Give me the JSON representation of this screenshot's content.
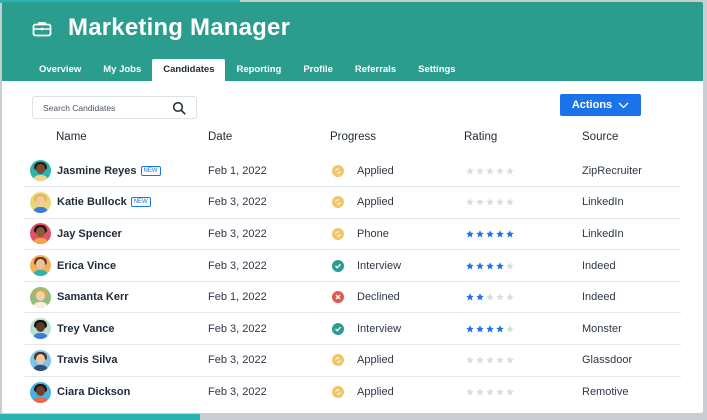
{
  "header": {
    "title": "Marketing Manager",
    "tabs": [
      {
        "label": "Overview",
        "active": false
      },
      {
        "label": "My Jobs",
        "active": false
      },
      {
        "label": "Candidates",
        "active": true
      },
      {
        "label": "Reporting",
        "active": false
      },
      {
        "label": "Profile",
        "active": false
      },
      {
        "label": "Referrals",
        "active": false
      },
      {
        "label": "Settings",
        "active": false
      }
    ]
  },
  "toolbar": {
    "search_placeholder": "Search Candidates",
    "actions_label": "Actions"
  },
  "table": {
    "headers": {
      "name": "Name",
      "date": "Date",
      "progress": "Progress",
      "rating": "Rating",
      "source": "Source"
    },
    "new_badge": "NEW",
    "rows": [
      {
        "name": "Jasmine Reyes",
        "new": true,
        "date": "Feb 1, 2022",
        "progress": "Applied",
        "status": "applied",
        "rating": 0,
        "source": "ZipRecruiter",
        "avatar": "jasmine"
      },
      {
        "name": "Katie Bullock",
        "new": true,
        "date": "Feb 3, 2022",
        "progress": "Applied",
        "status": "applied",
        "rating": 0,
        "source": "LinkedIn",
        "avatar": "katie"
      },
      {
        "name": "Jay Spencer",
        "new": false,
        "date": "Feb 3, 2022",
        "progress": "Phone",
        "status": "applied",
        "rating": 5,
        "source": "LinkedIn",
        "avatar": "jay"
      },
      {
        "name": "Erica Vince",
        "new": false,
        "date": "Feb 3, 2022",
        "progress": "Interview",
        "status": "interview",
        "rating": 4,
        "source": "Indeed",
        "avatar": "erica"
      },
      {
        "name": "Samanta Kerr",
        "new": false,
        "date": "Feb 1, 2022",
        "progress": "Declined",
        "status": "declined",
        "rating": 2,
        "source": "Indeed",
        "avatar": "samanta"
      },
      {
        "name": "Trey Vance",
        "new": false,
        "date": "Feb 3, 2022",
        "progress": "Interview",
        "status": "interview",
        "rating": 4,
        "source": "Monster",
        "avatar": "trey"
      },
      {
        "name": "Travis Silva",
        "new": false,
        "date": "Feb 3, 2022",
        "progress": "Applied",
        "status": "applied",
        "rating": 0,
        "source": "Glassdoor",
        "avatar": "travis"
      },
      {
        "name": "Ciara Dickson",
        "new": false,
        "date": "Feb 3, 2022",
        "progress": "Applied",
        "status": "applied",
        "rating": 0,
        "source": "Remotive",
        "avatar": "ciara"
      }
    ]
  },
  "colors": {
    "header_bg": "#2a9d8f",
    "accent_blue": "#1a73e8",
    "status_applied": "#f2c46b",
    "status_interview": "#2a9d8f",
    "status_declined": "#e05a4f",
    "star_on": "#1a73e8",
    "star_off": "#d9dde2"
  },
  "icons": {
    "briefcase": "briefcase-icon",
    "search": "search-icon",
    "actions_chevron": "chevron-down-icon",
    "star": "star-icon"
  }
}
